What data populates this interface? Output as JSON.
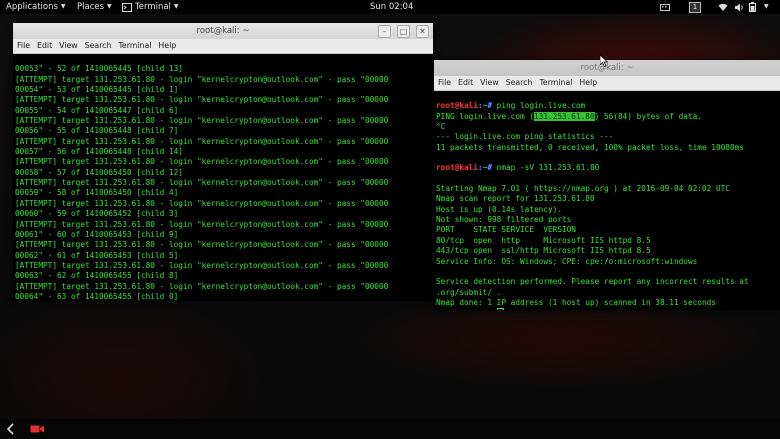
{
  "topbar": {
    "applications": "Applications",
    "places": "Places",
    "terminal": "Terminal",
    "clock": "Sun 02:04",
    "workspace": "1"
  },
  "win1": {
    "title": "root@kali: ~",
    "menu": [
      "File",
      "Edit",
      "View",
      "Search",
      "Terminal",
      "Help"
    ],
    "lines": [
      "00053\" - 52 of 1410065445 [child 13]",
      "[ATTEMPT] target 131.253.61.80 - login \"kernelcrypton@outlook.com\" - pass \"00000",
      "00054\" - 53 of 1410065445 [child 1]",
      "[ATTEMPT] target 131.253.61.80 - login \"kernelcrypton@outlook.com\" - pass \"00000",
      "00055\" - 54 of 1410065447 [child 6]",
      "[ATTEMPT] target 131.253.61.80 - login \"kernelcrypton@outlook.com\" - pass \"00000",
      "00056\" - 55 of 1410065448 [child 7]",
      "[ATTEMPT] target 131.253.61.80 - login \"kernelcrypton@outlook.com\" - pass \"00000",
      "00057\" - 56 of 1410065448 [child 14]",
      "[ATTEMPT] target 131.253.61.80 - login \"kernelcrypton@outlook.com\" - pass \"00000",
      "00058\" - 57 of 1410065450 [child 12]",
      "[ATTEMPT] target 131.253.61.80 - login \"kernelcrypton@outlook.com\" - pass \"00000",
      "00059\" - 58 of 1410065450 [child 4]",
      "[ATTEMPT] target 131.253.61.80 - login \"kernelcrypton@outlook.com\" - pass \"00000",
      "00060\" - 59 of 1410065452 [child 3]",
      "[ATTEMPT] target 131.253.61.80 - login \"kernelcrypton@outlook.com\" - pass \"00000",
      "00061\" - 60 of 1410065453 [child 9]",
      "[ATTEMPT] target 131.253.61.80 - login \"kernelcrypton@outlook.com\" - pass \"00000",
      "00062\" - 61 of 1410065453 [child 5]",
      "[ATTEMPT] target 131.253.61.80 - login \"kernelcrypton@outlook.com\" - pass \"00000",
      "00063\" - 62 of 1410065455 [child 8]",
      "[ATTEMPT] target 131.253.61.80 - login \"kernelcrypton@outlook.com\" - pass \"00000",
      "00064\" - 63 of 1410065455 [child 0]"
    ]
  },
  "win2": {
    "title": "root@kali: ~",
    "menu": [
      "File",
      "Edit",
      "View",
      "Search",
      "Terminal",
      "Help"
    ],
    "prompt_user": "root@kali",
    "prompt_path": ":~#",
    "cmd1": " ping login.live.com",
    "ping_pre": "PING login.live.com (",
    "ping_ip": "131.253.61.80",
    "ping_post": ") 56(84) bytes of data.",
    "ctrl_c": "^C",
    "stats_header": "--- login.live.com ping statistics ---",
    "stats_line": "11 packets transmitted, 0 received, 100% packet loss, time 10080ms",
    "cmd2": " nmap -sV 131.253.61.80",
    "nmap_lines": [
      "Starting Nmap 7.01 ( https://nmap.org ) at 2016-09-04 02:02 UTC",
      "Nmap scan report for 131.253.61.80",
      "Host is up (0.14s latency).",
      "Not shown: 998 filtered ports",
      "PORT    STATE SERVICE  VERSION",
      "80/tcp  open  http     Microsoft IIS httpd 8.5",
      "443/tcp open  ssl/http Microsoft IIS httpd 8.5",
      "Service Info: OS: Windows; CPE: cpe:/o:microsoft:windows"
    ],
    "done_lines": [
      "Service detection performed. Please report any incorrect results at",
      ".org/submit/ .",
      "Nmap done: 1 IP address (1 host up) scanned in 38.11 seconds"
    ]
  }
}
